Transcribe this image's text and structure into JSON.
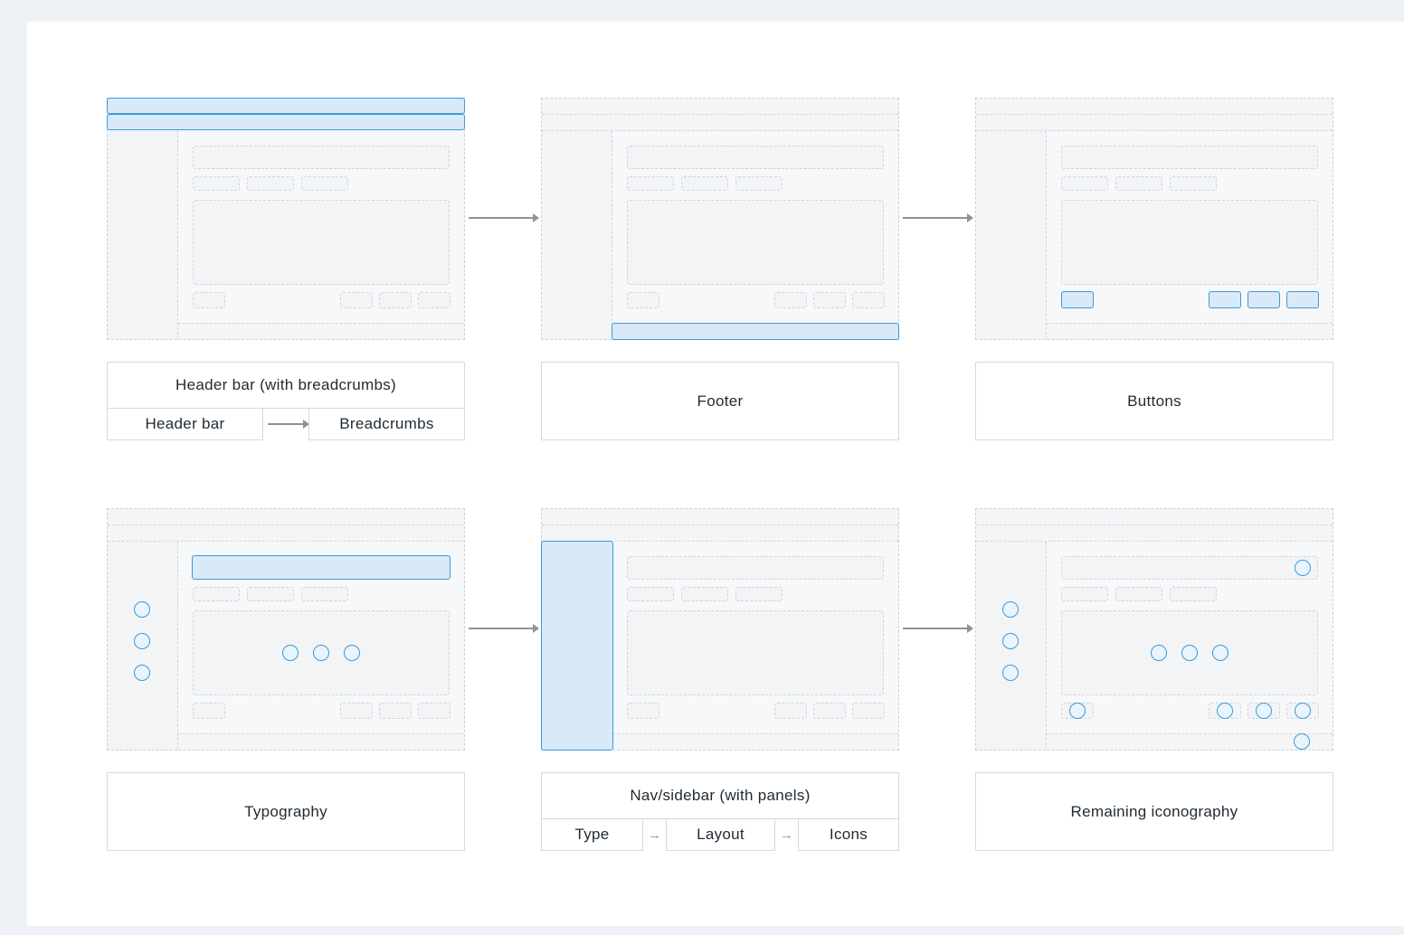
{
  "panels": {
    "header": {
      "title": "Header bar (with breadcrumbs)",
      "steps": [
        "Header bar",
        "Breadcrumbs"
      ]
    },
    "footer": {
      "title": "Footer"
    },
    "buttons": {
      "title": "Buttons"
    },
    "typography": {
      "title": "Typography"
    },
    "nav": {
      "title": "Nav/sidebar (with panels)",
      "steps": [
        "Type",
        "Layout",
        "Icons"
      ]
    },
    "iconography": {
      "title": "Remaining iconography"
    }
  },
  "colors": {
    "highlight": "#3b9ad9",
    "highlight_fill": "#d9e9f7",
    "arrow": "#8a949c"
  },
  "icons": {
    "flow_arrow": "arrow-right-icon",
    "marker": "circle-icon"
  }
}
